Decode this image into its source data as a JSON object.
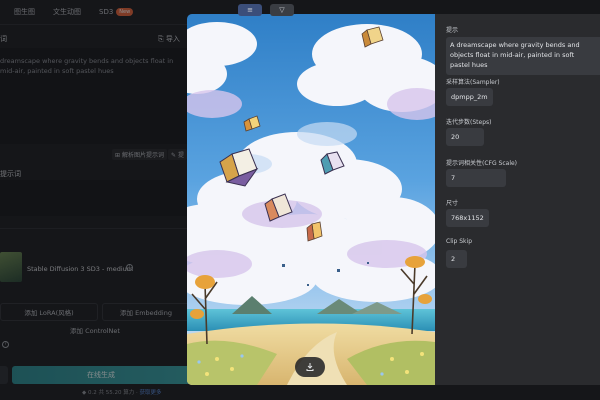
{
  "tabs": {
    "items": [
      {
        "label": "图生图"
      },
      {
        "label": "文生动图"
      },
      {
        "label": "SD3",
        "badge": "New"
      }
    ]
  },
  "toolbar": {
    "view_icon": "≡",
    "filter_icon": "▽"
  },
  "prompt_panel": {
    "label": "词",
    "import_label": "导入",
    "text": "dreamscape where gravity bends and objects float in mid-air, painted in soft pastel hues",
    "parse_button": "解析图片提示词",
    "parse_button2": "提",
    "negative_label": "提示词"
  },
  "model": {
    "name": "Stable Diffusion 3 SD3 - medium",
    "info_icon": "i"
  },
  "addons": {
    "lora": "添加 LoRA(风格)",
    "embedding": "添加 Embedding",
    "controlnet": "添加 ControlNet"
  },
  "generate": {
    "label": "在线生成",
    "footer_prefix": "0.2 共 55.20 算力 · ",
    "footer_link": "获取更多"
  },
  "details": {
    "prompt_label": "提示",
    "prompt_value": "A dreamscape where gravity bends and objects float in mid-air, painted in soft pastel hues",
    "sampler_label": "采样算法(Sampler)",
    "sampler_value": "dpmpp_2m",
    "steps_label": "迭代步数(Steps)",
    "steps_value": "20",
    "cfg_label": "提示词相关性(CFG Scale)",
    "cfg_value": "7",
    "size_label": "尺寸",
    "size_value": "768x1152",
    "clip_label": "Clip Skip",
    "clip_value": "2"
  },
  "icons": {
    "download": "download-icon",
    "help": "help-icon",
    "info": "info-icon"
  },
  "colors": {
    "accent": "#3a9fa4",
    "modal_bg": "#2a2b2e",
    "value_bg": "#393b40",
    "badge": "#e0643c"
  }
}
